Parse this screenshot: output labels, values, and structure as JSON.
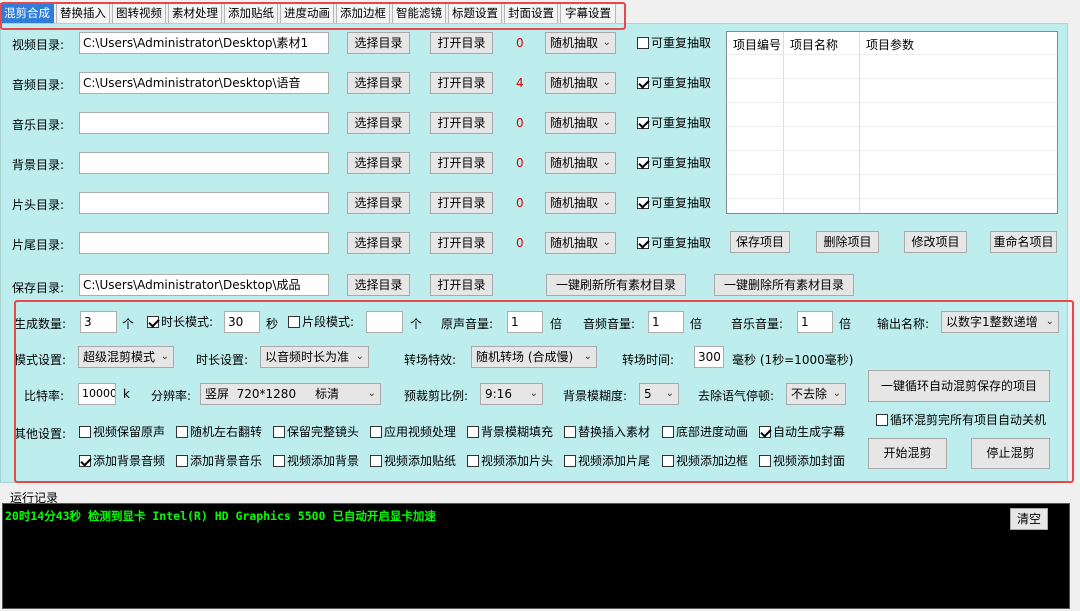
{
  "tabs": [
    "混剪合成",
    "替换插入",
    "图转视频",
    "素材处理",
    "添加贴纸",
    "进度动画",
    "添加边框",
    "智能滤镜",
    "标题设置",
    "封面设置",
    "字幕设置"
  ],
  "dirs": [
    {
      "label": "视频目录:",
      "value": "C:\\Users\\Administrator\\Desktop\\素材1",
      "count": "0",
      "mode": "随机抽取",
      "repeat_label": "可重复抽取",
      "repeat": false
    },
    {
      "label": "音频目录:",
      "value": "C:\\Users\\Administrator\\Desktop\\语音",
      "count": "4",
      "mode": "随机抽取",
      "repeat_label": "可重复抽取",
      "repeat": true
    },
    {
      "label": "音乐目录:",
      "value": "",
      "count": "0",
      "mode": "随机抽取",
      "repeat_label": "可重复抽取",
      "repeat": true
    },
    {
      "label": "背景目录:",
      "value": "",
      "count": "0",
      "mode": "随机抽取",
      "repeat_label": "可重复抽取",
      "repeat": true
    },
    {
      "label": "片头目录:",
      "value": "",
      "count": "0",
      "mode": "随机抽取",
      "repeat_label": "可重复抽取",
      "repeat": true
    },
    {
      "label": "片尾目录:",
      "value": "",
      "count": "0",
      "mode": "随机抽取",
      "repeat_label": "可重复抽取",
      "repeat": true
    }
  ],
  "save_dir": {
    "label": "保存目录:",
    "value": "C:\\Users\\Administrator\\Desktop\\成品"
  },
  "btn_select_dir": "选择目录",
  "btn_open_dir": "打开目录",
  "project_list": {
    "headers": [
      "项目编号",
      "项目名称",
      "项目参数"
    ]
  },
  "project_buttons": [
    "保存项目",
    "删除项目",
    "修改项目",
    "重命名项目"
  ],
  "refresh_all": "一键刷新所有素材目录",
  "delete_all": "一键删除所有素材目录",
  "settings": {
    "gen_count_label": "生成数量:",
    "gen_count": "3",
    "gen_unit": "个",
    "duration_mode_label": "时长模式:",
    "duration_mode_on": true,
    "duration": "30",
    "duration_unit": "秒",
    "segment_mode_label": "片段模式:",
    "segment_mode_on": false,
    "segment": "",
    "segment_unit": "个",
    "orig_vol_label": "原声音量:",
    "orig_vol": "1",
    "vol_unit": "倍",
    "audio_vol_label": "音频音量:",
    "audio_vol": "1",
    "music_vol_label": "音乐音量:",
    "music_vol": "1",
    "output_name_label": "输出名称:",
    "output_name": "以数字1整数递增",
    "mode_label": "模式设置:",
    "mode": "超级混剪模式",
    "dur_setting_label": "时长设置:",
    "dur_setting": "以音频时长为准",
    "transition_label": "转场特效:",
    "transition": "随机转场 (合成慢)",
    "transition_time_label": "转场时间:",
    "transition_time": "300",
    "transition_time_unit": "毫秒 (1秒=1000毫秒)",
    "bitrate_label": "比特率:",
    "bitrate": "10000",
    "bitrate_unit": "k",
    "resolution_label": "分辨率:",
    "resolution": "竖屏  720*1280     标清",
    "crop_ratio_label": "预裁剪比例:",
    "crop_ratio": "9:16",
    "blur_label": "背景模糊度:",
    "blur": "5",
    "remove_pause_label": "去除语气停顿:",
    "remove_pause": "不去除",
    "loop_button": "一键循环自动混剪保存的项目",
    "shutdown_label": "循环混剪完所有项目自动关机",
    "shutdown": false,
    "other_label": "其他设置:",
    "start_button": "开始混剪",
    "stop_button": "停止混剪"
  },
  "other_options": [
    {
      "label": "视频保留原声",
      "checked": false
    },
    {
      "label": "随机左右翻转",
      "checked": false
    },
    {
      "label": "保留完整镜头",
      "checked": false
    },
    {
      "label": "应用视频处理",
      "checked": false
    },
    {
      "label": "背景模糊填充",
      "checked": false
    },
    {
      "label": "替换插入素材",
      "checked": false
    },
    {
      "label": "底部进度动画",
      "checked": false
    },
    {
      "label": "自动生成字幕",
      "checked": true
    },
    {
      "label": "添加背景音频",
      "checked": true
    },
    {
      "label": "添加背景音乐",
      "checked": false
    },
    {
      "label": "视频添加背景",
      "checked": false
    },
    {
      "label": "视频添加贴纸",
      "checked": false
    },
    {
      "label": "视频添加片头",
      "checked": false
    },
    {
      "label": "视频添加片尾",
      "checked": false
    },
    {
      "label": "视频添加边框",
      "checked": false
    },
    {
      "label": "视频添加封面",
      "checked": false
    }
  ],
  "log": {
    "title": "运行记录",
    "lines": [
      "20时14分43秒  检测到显卡  Intel(R) HD Graphics 5500  已自动开启显卡加速"
    ],
    "clear_button": "清空"
  },
  "colors": {
    "panel_bg": "#bdeeed",
    "active_tab": "#2f7dd8",
    "highlight_box": "#e8474c",
    "count_red": "#e00000",
    "log_text": "#00ff00"
  }
}
